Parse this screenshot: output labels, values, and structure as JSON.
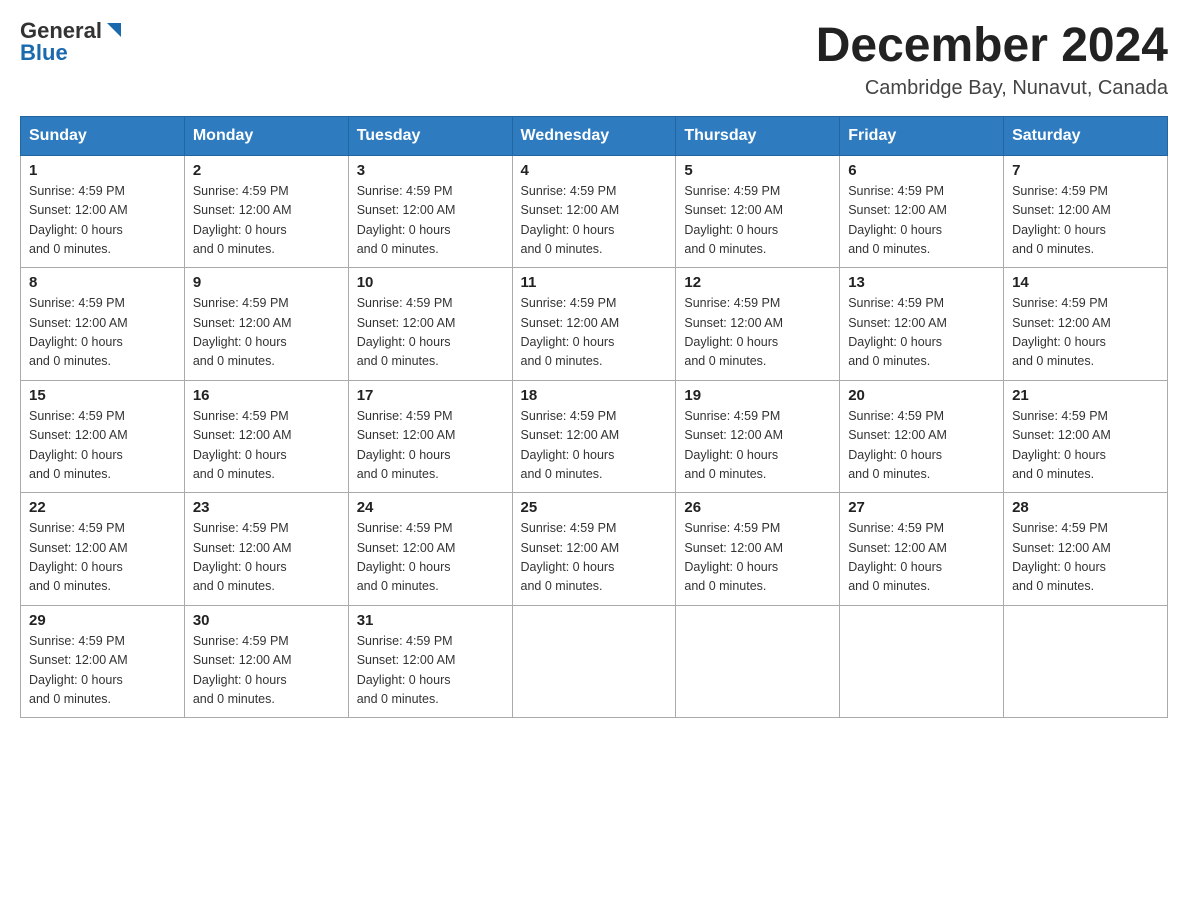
{
  "header": {
    "logo_general": "General",
    "logo_blue": "Blue",
    "month_title": "December 2024",
    "location": "Cambridge Bay, Nunavut, Canada"
  },
  "days_of_week": [
    "Sunday",
    "Monday",
    "Tuesday",
    "Wednesday",
    "Thursday",
    "Friday",
    "Saturday"
  ],
  "day_info": {
    "sunrise": "Sunrise: 4:59 PM",
    "sunset": "Sunset: 12:00 AM",
    "daylight": "Daylight: 0 hours",
    "minutes": "and 0 minutes."
  },
  "weeks": [
    [
      {
        "day": "1",
        "info": true
      },
      {
        "day": "2",
        "info": true
      },
      {
        "day": "3",
        "info": true
      },
      {
        "day": "4",
        "info": true
      },
      {
        "day": "5",
        "info": true
      },
      {
        "day": "6",
        "info": true
      },
      {
        "day": "7",
        "info": true
      }
    ],
    [
      {
        "day": "8",
        "info": true
      },
      {
        "day": "9",
        "info": true
      },
      {
        "day": "10",
        "info": true
      },
      {
        "day": "11",
        "info": true
      },
      {
        "day": "12",
        "info": true
      },
      {
        "day": "13",
        "info": true
      },
      {
        "day": "14",
        "info": true
      }
    ],
    [
      {
        "day": "15",
        "info": true
      },
      {
        "day": "16",
        "info": true
      },
      {
        "day": "17",
        "info": true
      },
      {
        "day": "18",
        "info": true
      },
      {
        "day": "19",
        "info": true
      },
      {
        "day": "20",
        "info": true
      },
      {
        "day": "21",
        "info": true
      }
    ],
    [
      {
        "day": "22",
        "info": true
      },
      {
        "day": "23",
        "info": true
      },
      {
        "day": "24",
        "info": true
      },
      {
        "day": "25",
        "info": true
      },
      {
        "day": "26",
        "info": true
      },
      {
        "day": "27",
        "info": true
      },
      {
        "day": "28",
        "info": true
      }
    ],
    [
      {
        "day": "29",
        "info": true
      },
      {
        "day": "30",
        "info": true
      },
      {
        "day": "31",
        "info": true
      },
      {
        "day": "",
        "info": false
      },
      {
        "day": "",
        "info": false
      },
      {
        "day": "",
        "info": false
      },
      {
        "day": "",
        "info": false
      }
    ]
  ]
}
